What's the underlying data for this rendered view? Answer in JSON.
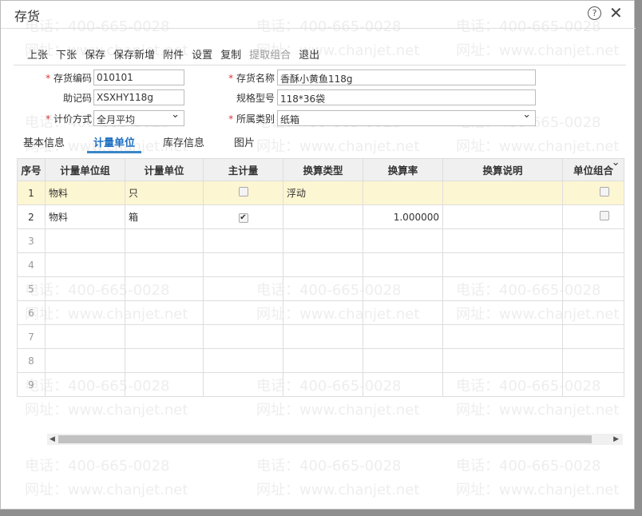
{
  "title": "存货",
  "toolbar": [
    "上张",
    "下张",
    "保存",
    "保存新增",
    "附件",
    "设置",
    "复制",
    "提取组合",
    "退出"
  ],
  "toolbar_disabled": "提取组合",
  "form": {
    "code_label": "存货编码",
    "code": "010101",
    "name_label": "存货名称",
    "name": "香酥小黄鱼118g",
    "mnemonic_label": "助记码",
    "mnemonic": "XSXHY118g",
    "spec_label": "规格型号",
    "spec": "118*36袋",
    "pricing_label": "计价方式",
    "pricing": "全月平均",
    "category_label": "所属类别",
    "category": "纸箱"
  },
  "tabs": [
    "基本信息",
    "计量单位",
    "库存信息",
    "图片"
  ],
  "active_tab": "计量单位",
  "table": {
    "headers": [
      "序号",
      "计量单位组",
      "计量单位",
      "主计量",
      "换算类型",
      "换算率",
      "换算说明",
      "单位组合"
    ],
    "rows": [
      {
        "no": "1",
        "group": "物料",
        "unit": "只",
        "main": false,
        "type": "浮动",
        "rate": "",
        "desc": "",
        "combo": false
      },
      {
        "no": "2",
        "group": "物料",
        "unit": "箱",
        "main": true,
        "type": "",
        "rate": "1.000000",
        "desc": "",
        "combo": false
      },
      {
        "no": "3"
      },
      {
        "no": "4"
      },
      {
        "no": "5"
      },
      {
        "no": "6"
      },
      {
        "no": "7"
      },
      {
        "no": "8"
      },
      {
        "no": "9"
      }
    ]
  },
  "watermark": {
    "phone": "电话：400-665-0028",
    "site": "网址：www.chanjet.net"
  }
}
